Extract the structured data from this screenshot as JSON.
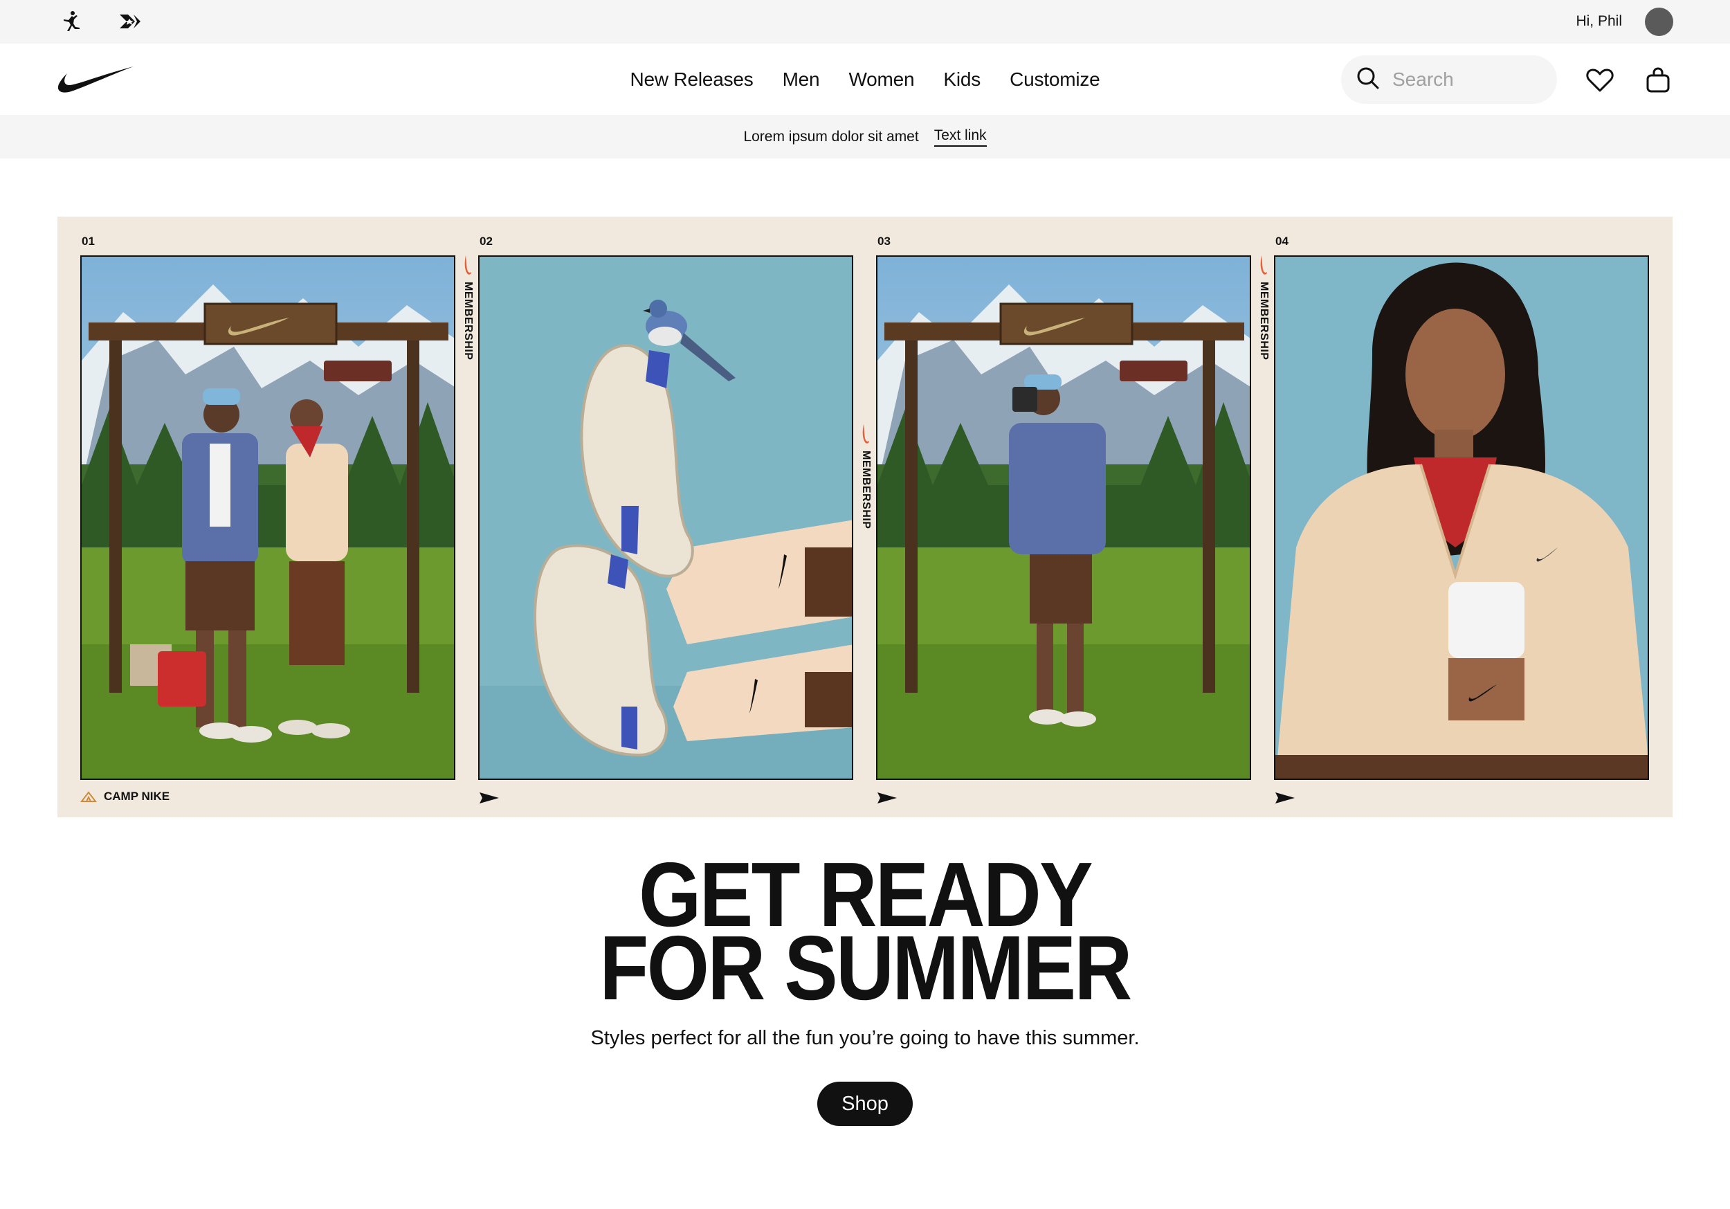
{
  "utility": {
    "greeting": "Hi, Phil",
    "brand_icons": [
      "jordan-jumpman-icon",
      "converse-star-chevron-icon"
    ]
  },
  "header": {
    "logo": "nike-swoosh-icon",
    "nav": [
      "New Releases",
      "Men",
      "Women",
      "Kids",
      "Customize"
    ],
    "search_placeholder": "Search",
    "icons": [
      "search-icon",
      "heart-icon",
      "bag-icon"
    ]
  },
  "promo": {
    "text": "Lorem ipsum dolor sit amet",
    "link": "Text link"
  },
  "hero": {
    "panels": [
      {
        "number": "01",
        "scene": "camp-nike-couple"
      },
      {
        "number": "02",
        "scene": "sneakers-with-blue-jay"
      },
      {
        "number": "03",
        "scene": "camp-nike-man-with-camera"
      },
      {
        "number": "04",
        "scene": "woman-in-quilted-jacket"
      }
    ],
    "membership_label": "MEMBERSHIP",
    "footer_label": "CAMP NIKE"
  },
  "headline": {
    "line1": "GET READY",
    "line2": "FOR SUMMER"
  },
  "subline": "Styles perfect for all the fun you’re going to have this summer.",
  "cta": {
    "label": "Shop"
  },
  "colors": {
    "brand_black": "#111111",
    "utility_bg": "#f5f5f5",
    "hero_frame_bg": "#f1e9de",
    "swoosh_accent": "#e3603a"
  }
}
